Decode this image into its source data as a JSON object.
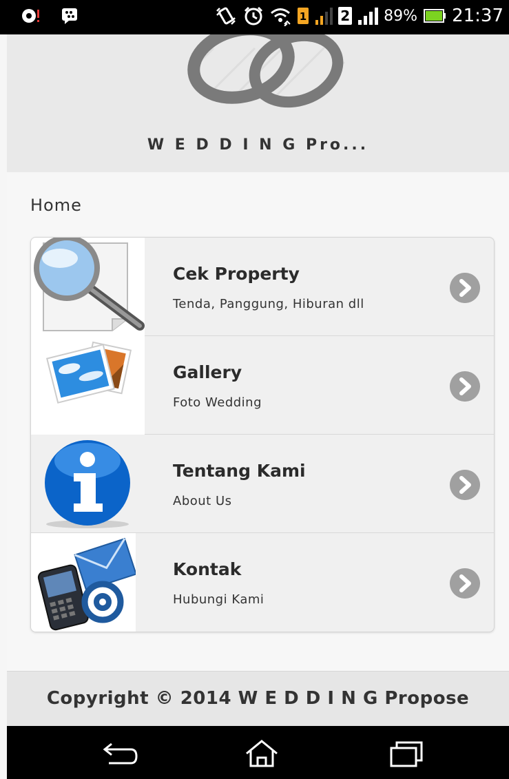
{
  "status_bar": {
    "battery_percent": "89%",
    "time": "21:37",
    "sim_2_label": "2",
    "icons": [
      "notification-icon",
      "bbm-icon",
      "vibrate-icon",
      "alarm-icon",
      "wifi-icon",
      "sim1-icon",
      "signal-icon",
      "signal2-icon",
      "battery-icon"
    ]
  },
  "header": {
    "title": "W E D D I N G Pro...",
    "logo": "rings-logo"
  },
  "breadcrumb": "Home",
  "menu": {
    "items": [
      {
        "title": "Cek Property",
        "subtitle": "Tenda, Panggung, Hiburan dll",
        "icon": "magnifier-document-icon"
      },
      {
        "title": "Gallery",
        "subtitle": "Foto Wedding",
        "icon": "photos-icon"
      },
      {
        "title": "Tentang Kami",
        "subtitle": "About Us",
        "icon": "info-icon"
      },
      {
        "title": "Kontak",
        "subtitle": "Hubungi Kami",
        "icon": "phone-mail-icon"
      }
    ]
  },
  "footer": {
    "copyright": "Copyright © 2014 W E D D I N G Propose"
  },
  "nav_bar": {
    "buttons": [
      "back-icon",
      "home-icon",
      "recent-apps-icon"
    ]
  },
  "colors": {
    "header_bg": "#e9e9e9",
    "arrow": "#a0a0a0",
    "footer_bg": "#e6e6e6"
  }
}
